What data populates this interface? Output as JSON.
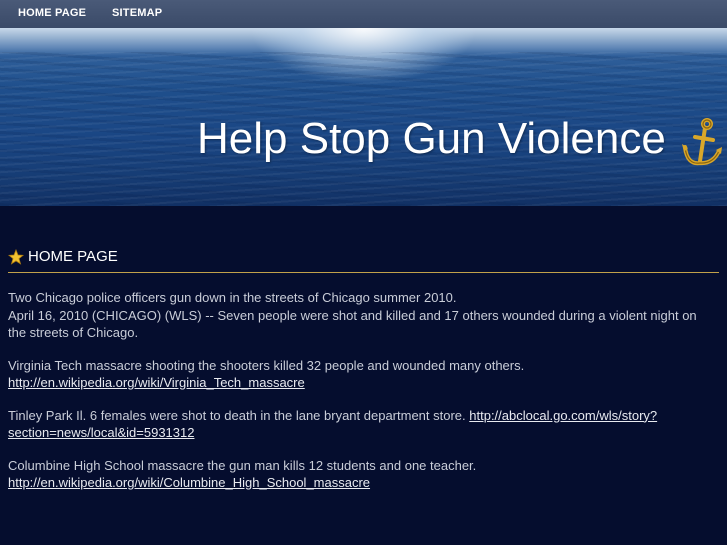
{
  "nav": {
    "home": "HOME PAGE",
    "sitemap": "SITEMAP"
  },
  "banner": {
    "title": "Help Stop Gun Violence",
    "icon": "anchor-icon"
  },
  "heading": {
    "icon": "star-icon",
    "text": "HOME PAGE"
  },
  "content": {
    "p1": {
      "line1": "Two Chicago police officers gun down in the streets of Chicago summer 2010.",
      "line2": "April 16, 2010 (CHICAGO) (WLS) -- Seven people were shot and killed and 17 others wounded during a violent night on the streets of Chicago."
    },
    "p2": {
      "text": "Virginia Tech massacre shooting the shooters killed 32 people and wounded many others.",
      "link": "http://en.wikipedia.org/wiki/Virginia_Tech_massacre "
    },
    "p3": {
      "text": "Tinley Park Il. 6 females were shot to death in the lane bryant department store. ",
      "link": "http://abclocal.go.com/wls/story?section=news/local&id=5931312"
    },
    "p4": {
      "text": "Columbine High School massacre the gun man kills 12 students and one teacher.",
      "link": "http://en.wikipedia.org/wiki/Columbine_High_School_massacre "
    }
  },
  "colors": {
    "background": "#050d2e",
    "accent": "#c2a14a",
    "link": "#e8eaf0"
  }
}
